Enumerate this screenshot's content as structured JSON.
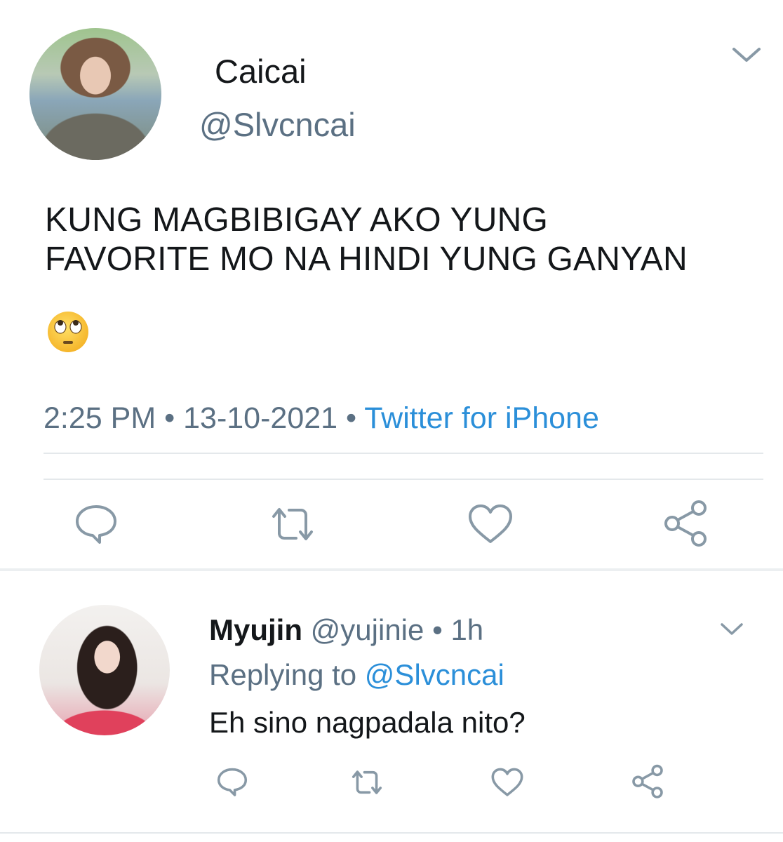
{
  "main_tweet": {
    "display_name": "Caicai",
    "handle": "@Slvcncai",
    "text_line1": "KUNG MAGBIBIGAY AKO YUNG",
    "text_line2": "FAVORITE MO NA HINDI YUNG GANYAN",
    "emoji": "face-with-rolling-eyes",
    "time": "2:25 PM",
    "separator": "•",
    "date": "13-10-2021",
    "source": "Twitter for iPhone",
    "actions": [
      "reply-icon",
      "retweet-icon",
      "like-icon",
      "share-icon"
    ]
  },
  "reply_tweet": {
    "display_name": "Myujin",
    "handle": "@yujinie",
    "separator": "•",
    "time_ago": "1h",
    "replying_prefix": "Replying to",
    "replying_handle": "@Slvcncai",
    "text": "Eh sino nagpadala nito?",
    "actions": [
      "reply-icon",
      "retweet-icon",
      "like-icon",
      "share-icon"
    ]
  },
  "colors": {
    "text_primary": "#14171a",
    "text_secondary": "#5b7083",
    "link": "#2b8fd9",
    "divider": "#e4e8eb",
    "icon": "#8899a6"
  }
}
